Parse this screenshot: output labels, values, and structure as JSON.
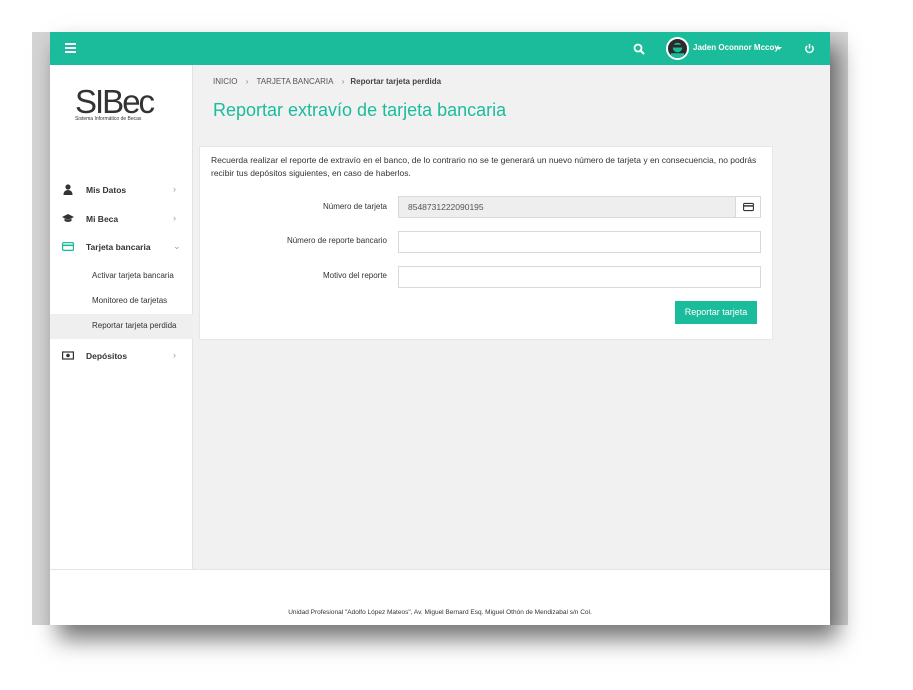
{
  "header": {
    "user_name": "Jaden Oconnor Mccoy",
    "accent_color": "#1bbc9b",
    "icons": [
      "menu-icon",
      "search-icon",
      "avatar",
      "caret-down-icon",
      "power-icon"
    ]
  },
  "logo": {
    "text": "SIBec",
    "subtitle": "Sistema Informático de Becas"
  },
  "sidebar": {
    "items": [
      {
        "label": "Mis Datos",
        "icon": "user-icon",
        "arrow": "›"
      },
      {
        "label": "Mi Beca",
        "icon": "graduation-cap-icon",
        "arrow": "›"
      },
      {
        "label": "Tarjeta bancaria",
        "icon": "credit-card-icon",
        "arrow": "⌄"
      },
      {
        "label": "Depósitos",
        "icon": "money-icon",
        "arrow": "›"
      }
    ],
    "subitems": [
      {
        "label": "Activar tarjeta bancaria"
      },
      {
        "label": "Monitoreo de tarjetas"
      },
      {
        "label": "Reportar tarjeta perdida",
        "active": true
      }
    ]
  },
  "breadcrumb": {
    "items": [
      "INICIO",
      "TARJETA BANCARIA",
      "Reportar tarjeta perdida"
    ],
    "separator": "›"
  },
  "page": {
    "title": "Reportar extravío de tarjeta bancaria",
    "notice": "Recuerda realizar el reporte de extravío en el banco, de lo contrario no se te generará un nuevo número de tarjeta y en consecuencia, no podrás recibir tus depósitos siguientes, en caso de haberlos."
  },
  "form": {
    "card_number_label": "Número de tarjeta",
    "card_number_value": "8548731222090195",
    "report_number_label": "Número de reporte bancario",
    "report_number_value": "",
    "reason_label": "Motivo del reporte",
    "reason_value": "",
    "submit_label": "Reportar tarjeta"
  },
  "footer": {
    "text": "Unidad Profesional \"Adolfo López Mateos\", Av. Miguel Bernard Esq. Miguel Othón de Mendizabal s/n Col."
  }
}
